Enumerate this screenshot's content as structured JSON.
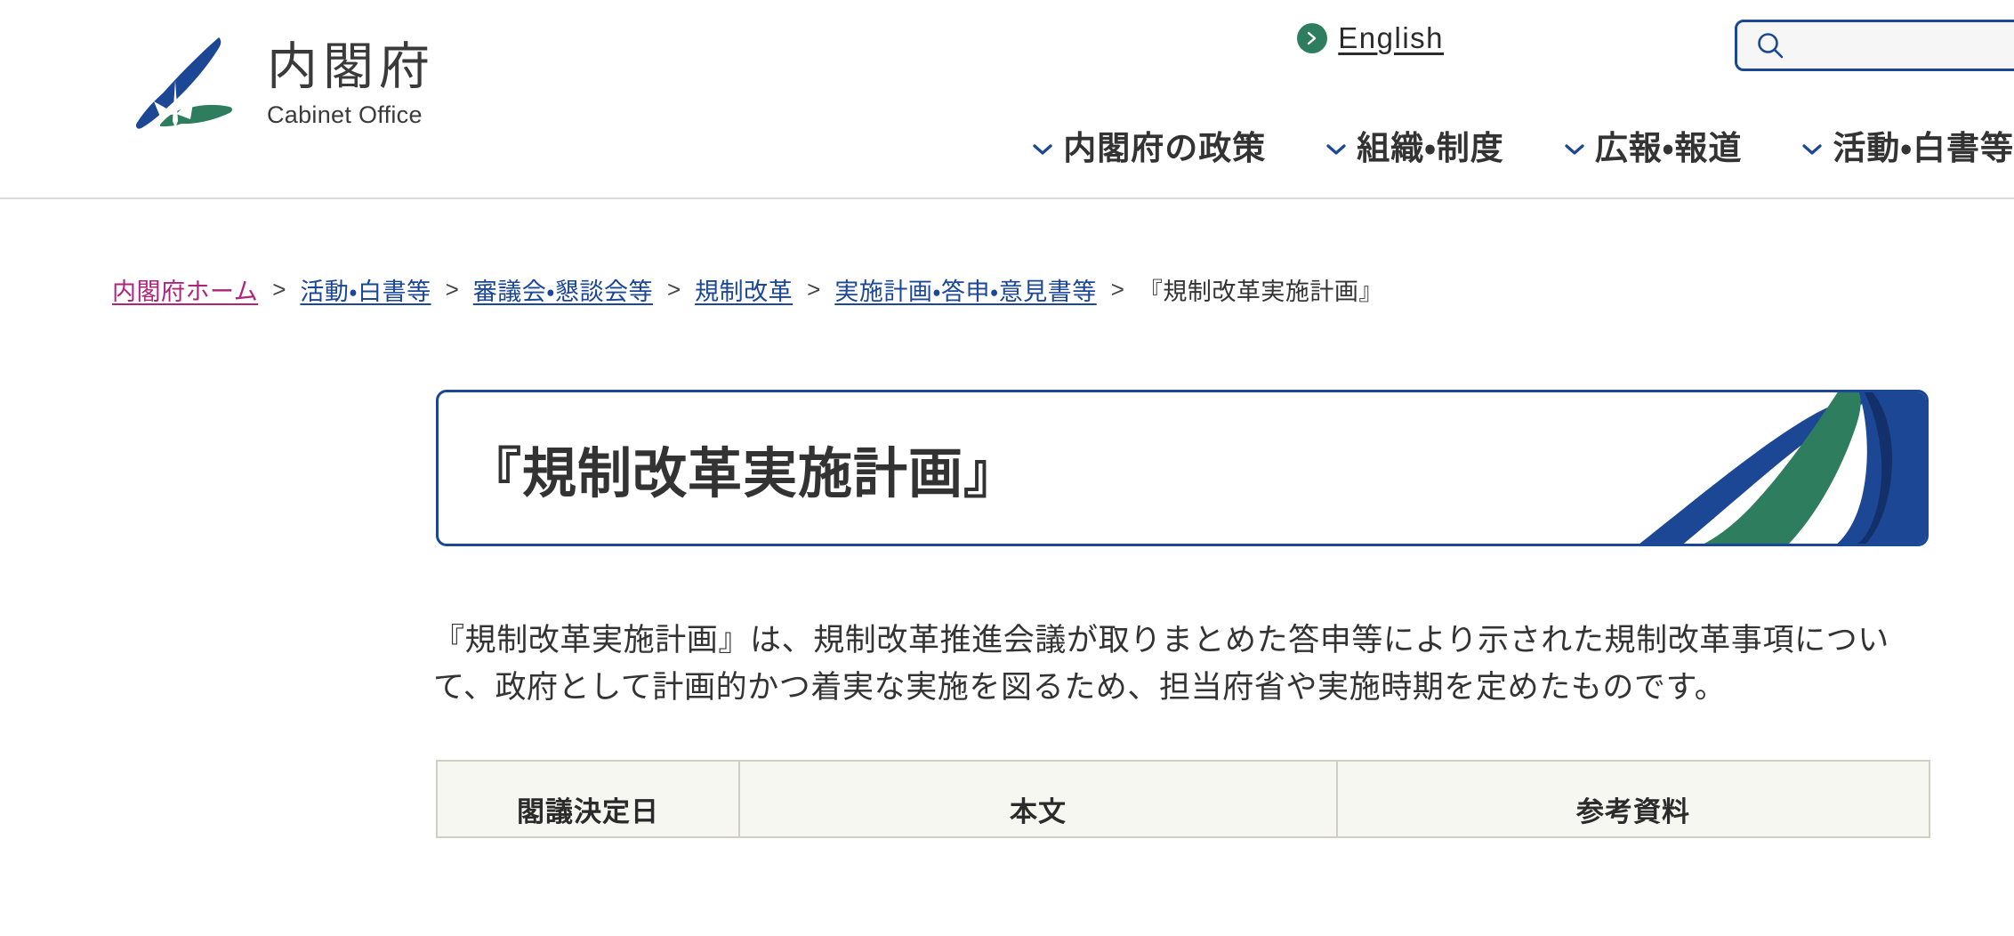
{
  "header": {
    "logo": {
      "mark_name": "cabinet-office-leaf-logo",
      "jp": "内閣府",
      "en": "Cabinet Office",
      "blue": "#1b4795",
      "green": "#2f7d5f"
    },
    "language_link": {
      "label": "English",
      "icon": "circle-arrow-right-icon",
      "icon_color": "#2f7d5f"
    },
    "search": {
      "icon": "search-icon",
      "value": "",
      "placeholder": "",
      "border_color": "#1b4795",
      "background": "#f6f6f6"
    },
    "nav": [
      {
        "label": "内閣府の政策",
        "icon": "chevron-down-icon"
      },
      {
        "label": "組織・制度",
        "icon": "chevron-down-icon"
      },
      {
        "label": "広報・報道",
        "icon": "chevron-down-icon"
      },
      {
        "label": "活動・白書等",
        "icon": "chevron-down-icon"
      }
    ]
  },
  "breadcrumb": {
    "separator": ">",
    "items": [
      {
        "label": "内閣府ホーム",
        "link": true,
        "visited": true
      },
      {
        "label": "活動・白書等",
        "link": true,
        "visited": false
      },
      {
        "label": "審議会・懇談会等",
        "link": true,
        "visited": false
      },
      {
        "label": "規制改革",
        "link": true,
        "visited": false
      },
      {
        "label": "実施計画・答申・意見書等",
        "link": true,
        "visited": false
      },
      {
        "label": "『規制改革実施計画』",
        "link": false,
        "visited": false
      }
    ]
  },
  "page": {
    "title": "『規制改革実施計画』",
    "lead": "『規制改革実施計画』は、規制改革推進会議が取りまとめた答申等により示された規制改革事項について、政府として計画的かつ着実な実施を図るため、担当府省や実施時期を定めたものです。"
  },
  "table": {
    "headers": [
      "閣議決定日",
      "本文",
      "参考資料"
    ],
    "header_background": "#f7f7f2",
    "border_color": "#cfcfc8"
  },
  "colors": {
    "brand_blue": "#1b4795",
    "brand_green": "#2f7d5f",
    "link_blue": "#1b4795",
    "visited_magenta": "#b0237a",
    "text": "#333333"
  }
}
